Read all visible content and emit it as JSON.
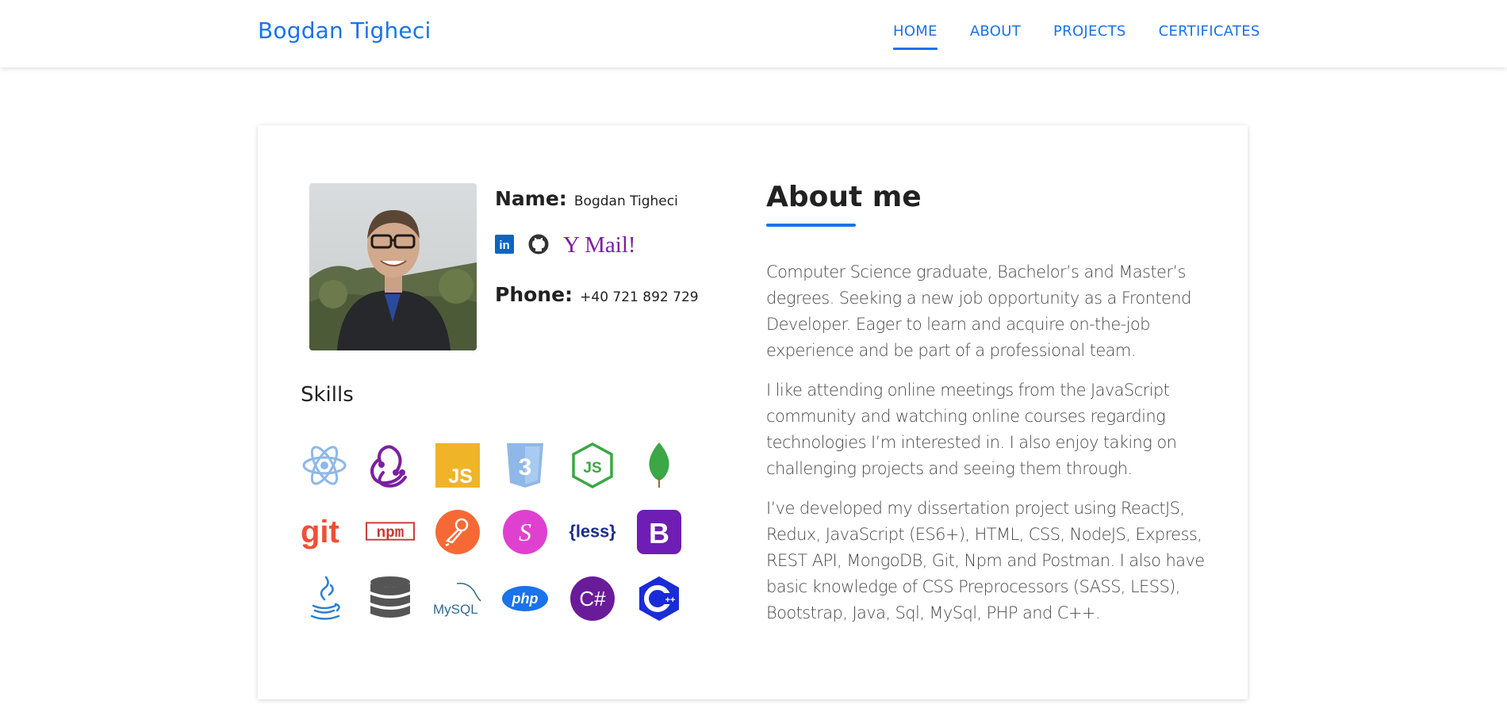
{
  "header": {
    "brand": "Bogdan Tigheci",
    "nav": [
      {
        "label": "HOME",
        "active": true
      },
      {
        "label": "ABOUT",
        "active": false
      },
      {
        "label": "PROJECTS",
        "active": false
      },
      {
        "label": "CERTIFICATES",
        "active": false
      }
    ]
  },
  "profile": {
    "name_label": "Name:",
    "name_value": "Bogdan Tigheci",
    "phone_label": "Phone:",
    "phone_value": "+40 721 892 729",
    "socials": [
      {
        "name": "linkedin-icon",
        "label": "in"
      },
      {
        "name": "github-icon",
        "label": ""
      },
      {
        "name": "yahoo-mail-icon",
        "label": "Y Mail!"
      }
    ]
  },
  "skills": {
    "title": "Skills",
    "items": [
      {
        "name": "react-icon",
        "label": ""
      },
      {
        "name": "redux-icon",
        "label": ""
      },
      {
        "name": "javascript-icon",
        "label": "JS"
      },
      {
        "name": "css3-icon",
        "label": "3"
      },
      {
        "name": "nodejs-icon",
        "label": "JS"
      },
      {
        "name": "mongodb-icon",
        "label": ""
      },
      {
        "name": "git-icon",
        "label": "git"
      },
      {
        "name": "npm-icon",
        "label": "npm"
      },
      {
        "name": "postman-icon",
        "label": ""
      },
      {
        "name": "sass-icon",
        "label": "S"
      },
      {
        "name": "less-icon",
        "label": "{less}"
      },
      {
        "name": "bootstrap-icon",
        "label": "B"
      },
      {
        "name": "java-icon",
        "label": ""
      },
      {
        "name": "sql-database-icon",
        "label": ""
      },
      {
        "name": "mysql-icon",
        "label": "MySQL"
      },
      {
        "name": "php-icon",
        "label": "php"
      },
      {
        "name": "csharp-icon",
        "label": "C#"
      },
      {
        "name": "cplusplus-icon",
        "label": "C++"
      }
    ]
  },
  "about": {
    "title": "About me",
    "paragraphs": [
      "Computer Science graduate, Bachelor’s and Master’s degrees. Seeking a new job opportunity as a Frontend Developer. Eager to learn and acquire on-the-job experience and be part of a professional team.",
      "I like attending online meetings from the JavaScript community and watching online courses regarding technologies I’m interested in. I also enjoy taking on challenging projects and seeing them through.",
      "I’ve developed my dissertation project using ReactJS, Redux, JavaScript (ES6+), HTML, CSS, NodeJS, Express, REST API, MongoDB, Git, Npm and Postman. I also have basic knowledge of CSS Preprocessors (SASS, LESS), Bootstrap, Java, Sql, MySql, PHP and C++."
    ]
  },
  "colors": {
    "accent": "#1a73e8",
    "text_dark": "#212121",
    "text_body": "#4a4a4a"
  }
}
